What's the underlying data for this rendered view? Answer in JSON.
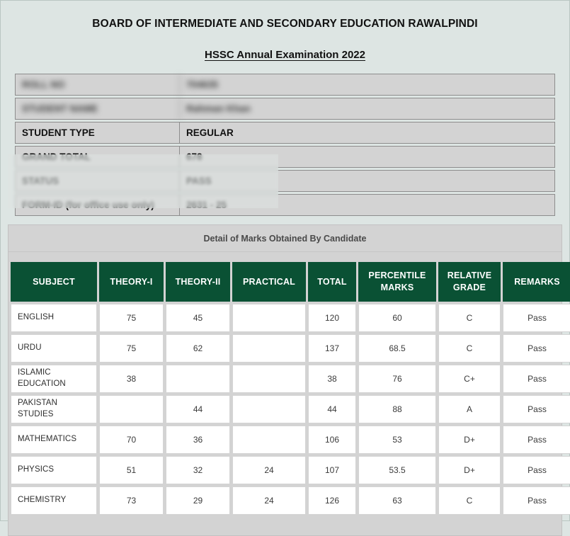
{
  "header": {
    "board_title": "BOARD OF INTERMEDIATE AND SECONDARY EDUCATION RAWALPINDI",
    "exam_title": "HSSC Annual Examination 2022"
  },
  "student_info": [
    {
      "label": "ROLL NO",
      "value": "704635",
      "redacted": true
    },
    {
      "label": "STUDENT NAME",
      "value": "Rahman Khan",
      "redacted": true
    },
    {
      "label": "STUDENT TYPE",
      "value": "REGULAR",
      "redacted": false
    },
    {
      "label": "GRAND TOTAL",
      "value": "678",
      "redacted": false
    },
    {
      "label": "STATUS",
      "value": "PASS",
      "redacted": false
    },
    {
      "label": "FORM-ID (for office use only)",
      "value": "2631 - 25",
      "redacted": false
    }
  ],
  "marks": {
    "caption": "Detail of Marks Obtained By Candidate",
    "columns": [
      "SUBJECT",
      "THEORY-I",
      "THEORY-II",
      "PRACTICAL",
      "TOTAL",
      "PERCENTILE MARKS",
      "RELATIVE GRADE",
      "REMARKS"
    ],
    "rows": [
      {
        "subject": "ENGLISH",
        "theory1": "75",
        "theory2": "45",
        "practical": "",
        "total": "120",
        "percentile": "60",
        "grade": "C",
        "remarks": "Pass"
      },
      {
        "subject": "URDU",
        "theory1": "75",
        "theory2": "62",
        "practical": "",
        "total": "137",
        "percentile": "68.5",
        "grade": "C",
        "remarks": "Pass"
      },
      {
        "subject": "ISLAMIC EDUCATION",
        "theory1": "38",
        "theory2": "",
        "practical": "",
        "total": "38",
        "percentile": "76",
        "grade": "C+",
        "remarks": "Pass"
      },
      {
        "subject": "PAKISTAN STUDIES",
        "theory1": "",
        "theory2": "44",
        "practical": "",
        "total": "44",
        "percentile": "88",
        "grade": "A",
        "remarks": "Pass"
      },
      {
        "subject": "MATHEMATICS",
        "theory1": "70",
        "theory2": "36",
        "practical": "",
        "total": "106",
        "percentile": "53",
        "grade": "D+",
        "remarks": "Pass"
      },
      {
        "subject": "PHYSICS",
        "theory1": "51",
        "theory2": "32",
        "practical": "24",
        "total": "107",
        "percentile": "53.5",
        "grade": "D+",
        "remarks": "Pass"
      },
      {
        "subject": "CHEMISTRY",
        "theory1": "73",
        "theory2": "29",
        "practical": "24",
        "total": "126",
        "percentile": "63",
        "grade": "C",
        "remarks": "Pass"
      }
    ]
  },
  "colors": {
    "page_background": "#dde5e3",
    "panel_background": "#d3d3d3",
    "table_header": "#0a5134",
    "text": "#111111"
  }
}
